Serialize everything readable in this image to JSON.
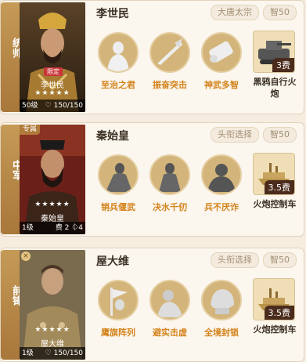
{
  "cards": [
    {
      "position": "统帅",
      "hero": {
        "name": "李世民",
        "portrait_name": "李世民",
        "lock_badge": "限定",
        "stars": "★★★★★",
        "level": "50级",
        "troops": "150/150"
      },
      "tags": [
        "大唐太宗",
        "智50"
      ],
      "skills": [
        {
          "label": "至治之君"
        },
        {
          "label": "振奋突击"
        },
        {
          "label": "神武多智"
        }
      ],
      "equip": {
        "label": "黑鸦自行火炮",
        "cost": "3费"
      }
    },
    {
      "position": "中军",
      "hero": {
        "name": "秦始皇",
        "portrait_name": "秦始皇",
        "special_badge": "专属",
        "stars": "★★★★★",
        "level": "1级",
        "cost_text": "费 2 ⏀4"
      },
      "tags": [
        "头衔选择",
        "智50"
      ],
      "skills": [
        {
          "label": "销兵偃武"
        },
        {
          "label": "决水千仞"
        },
        {
          "label": "兵不厌诈"
        }
      ],
      "equip": {
        "label": "火炮控制车",
        "cost": "3.5费"
      }
    },
    {
      "position": "前锋",
      "hero": {
        "name": "屋大维",
        "portrait_name": "屋大维",
        "stars": "★★★★★",
        "level": "1级",
        "troops": "150/150"
      },
      "tags": [
        "头衔选择",
        "智50"
      ],
      "skills": [
        {
          "label": "鹰旗阵列"
        },
        {
          "label": "避实击虚"
        },
        {
          "label": "全境封锁"
        }
      ],
      "equip": {
        "label": "火炮控制车",
        "cost": "3.5费"
      }
    }
  ]
}
